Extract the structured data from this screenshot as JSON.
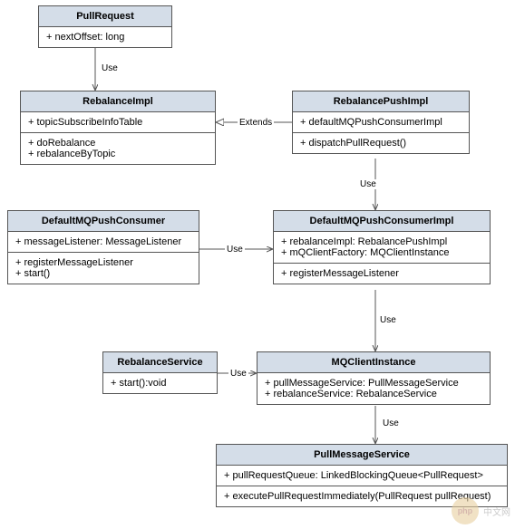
{
  "classes": {
    "pullRequest": {
      "name": "PullRequest",
      "attrs": [
        "+ nextOffset: long"
      ]
    },
    "rebalanceImpl": {
      "name": "RebalanceImpl",
      "attrs": [
        "+ topicSubscribeInfoTable"
      ],
      "methods": [
        "+ doRebalance",
        "+ rebalanceByTopic"
      ]
    },
    "rebalancePushImpl": {
      "name": "RebalancePushImpl",
      "attrs": [
        "+ defaultMQPushConsumerImpl"
      ],
      "methods": [
        "+ dispatchPullRequest()"
      ]
    },
    "defaultMQPushConsumer": {
      "name": "DefaultMQPushConsumer",
      "attrs": [
        "+ messageListener: MessageListener"
      ],
      "methods": [
        "+ registerMessageListener",
        "+ start()"
      ]
    },
    "defaultMQPushConsumerImpl": {
      "name": "DefaultMQPushConsumerImpl",
      "attrs": [
        "+ rebalanceImpl: RebalancePushImpl",
        "+ mQClientFactory:  MQClientInstance"
      ],
      "methods": [
        "+ registerMessageListener"
      ]
    },
    "rebalanceService": {
      "name": "RebalanceService",
      "methods": [
        "+ start():void"
      ]
    },
    "mqClientInstance": {
      "name": "MQClientInstance",
      "attrs": [
        "+ pullMessageService: PullMessageService",
        "+ rebalanceService: RebalanceService"
      ]
    },
    "pullMessageService": {
      "name": "PullMessageService",
      "attrs": [
        "+ pullRequestQueue: LinkedBlockingQueue<PullRequest>"
      ],
      "methods": [
        "+ executePullRequestImmediately(PullRequest pullRequest)"
      ]
    }
  },
  "labels": {
    "use": "Use",
    "extends": "Extends"
  },
  "watermark": {
    "logo": "php",
    "text": "中文网"
  }
}
